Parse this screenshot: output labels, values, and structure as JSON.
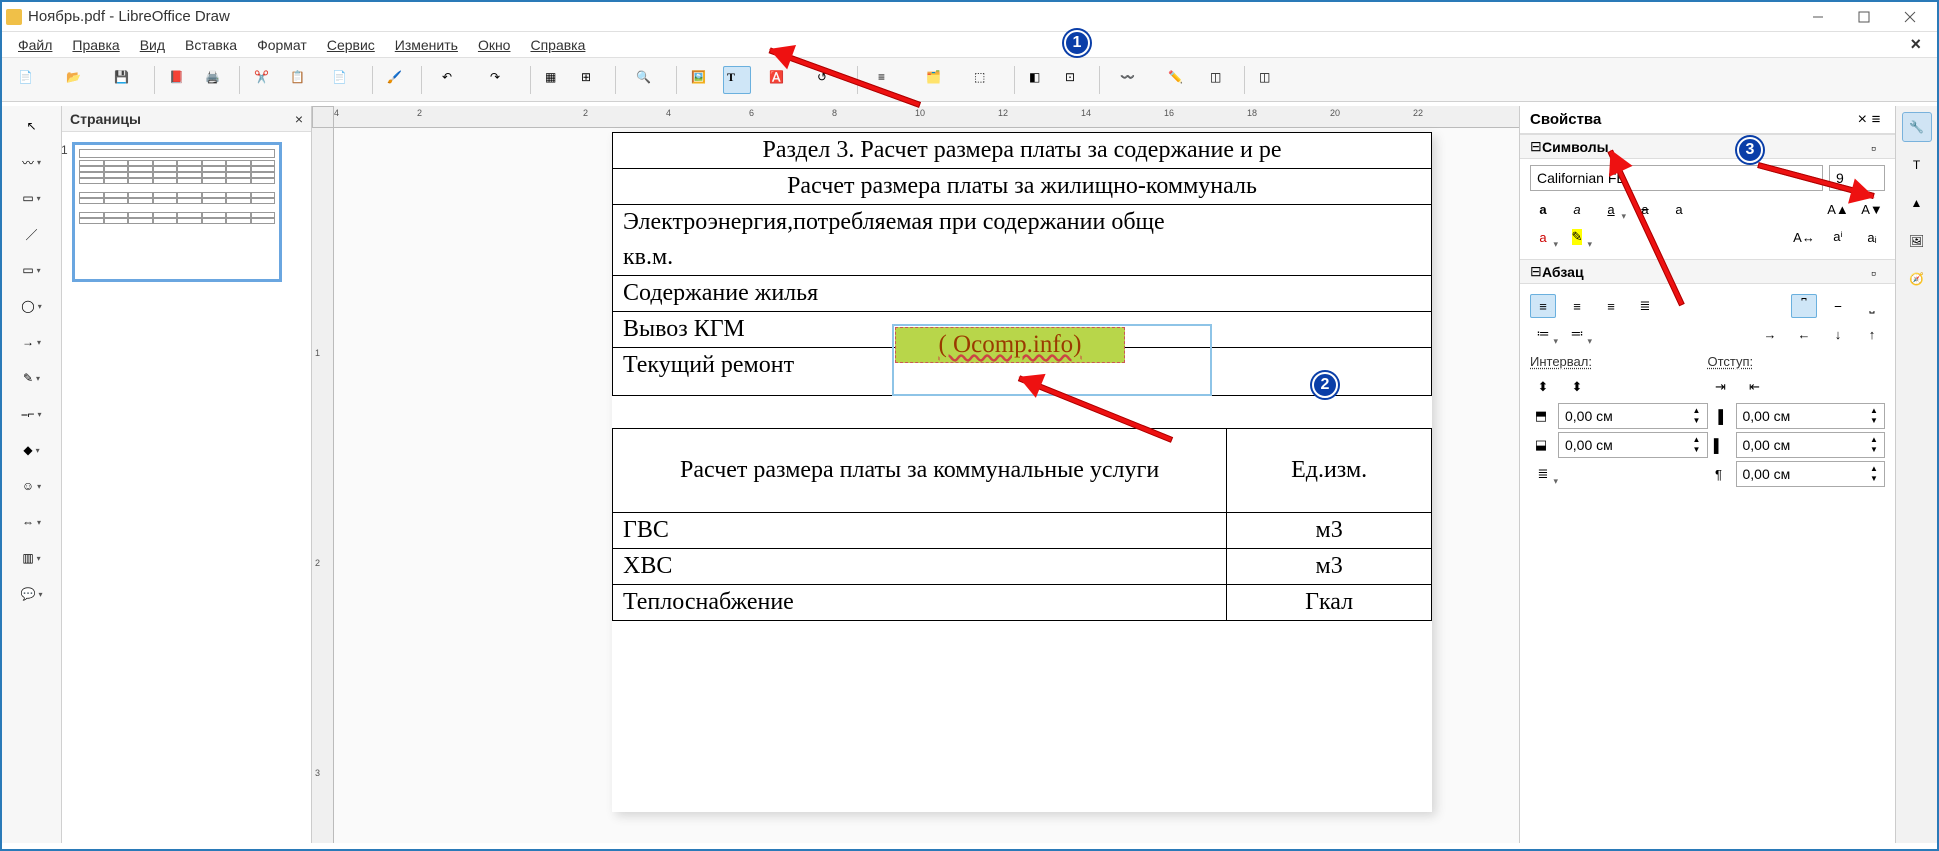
{
  "window": {
    "title": "Ноябрь.pdf - LibreOffice Draw"
  },
  "menu": {
    "file": "Файл",
    "edit": "Правка",
    "view": "Вид",
    "insert": "Вставка",
    "format": "Формат",
    "tools": "Сервис",
    "modify": "Изменить",
    "window": "Окно",
    "help": "Справка"
  },
  "panels": {
    "pages_title": "Страницы",
    "page_number": "1",
    "properties_title": "Свойства",
    "section_symbols": "Символы",
    "section_paragraph": "Абзац",
    "interval_label": "Интервал:",
    "indent_label": "Отступ:"
  },
  "font": {
    "name": "Californian FB",
    "size": "9"
  },
  "spacing": {
    "above": "0,00 см",
    "below": "0,00 см",
    "indent_before": "0,00 см",
    "indent_after": "0,00 см",
    "indent_first": "0,00 см"
  },
  "ruler": {
    "h": [
      "4",
      "2",
      "",
      "2",
      "4",
      "6",
      "8",
      "10",
      "12",
      "14",
      "16",
      "18",
      "20",
      "22"
    ],
    "v": [
      "",
      "1",
      "2",
      "3"
    ]
  },
  "document": {
    "title": "Раздел 3. Расчет размера платы за содержание и ре",
    "subtitle": "Расчет размера платы за жилищно-коммуналь",
    "row_elec": "Электроэнергия,потребляемая при содержании обще",
    "row_elec2": "кв.м.",
    "row_housing": "Содержание жилья",
    "row_kgm": "Вывоз КГМ",
    "row_repair": "Текущий ремонт",
    "inserted": "( Ocomp.info)",
    "t2_header_l": "Расчет размера платы за коммунальные услуги",
    "t2_header_r": "Ед.изм.",
    "r_gvs": "ГВС",
    "r_gvs_u": "м3",
    "r_hvs": "ХВС",
    "r_hvs_u": "м3",
    "r_heat": "Теплоснабжение",
    "r_heat_u": "Гкал"
  },
  "annotations": {
    "b1": "1",
    "b2": "2",
    "b3": "3"
  }
}
